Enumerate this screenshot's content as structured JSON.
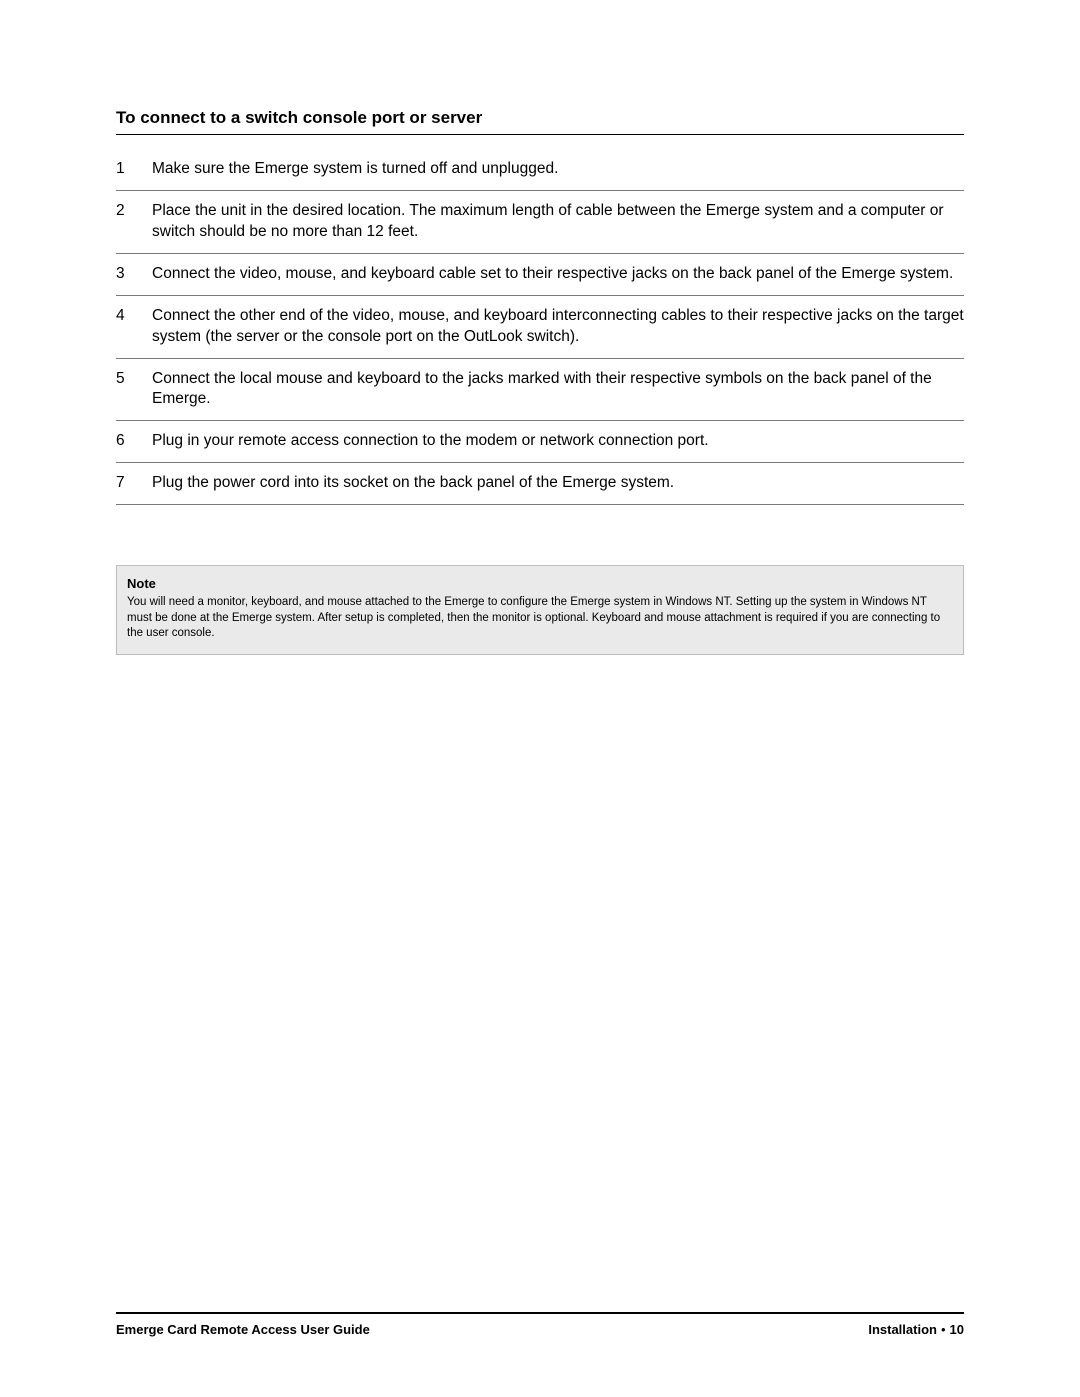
{
  "section": {
    "title": "To connect to a switch console port or server",
    "steps": [
      {
        "n": "1",
        "text": "Make sure the Emerge system is turned off and unplugged."
      },
      {
        "n": "2",
        "text": "Place the unit in the desired location. The maximum length of cable between the Emerge system and a computer or switch should be no more than 12 feet."
      },
      {
        "n": "3",
        "text": "Connect the video, mouse, and keyboard cable set to their respective jacks on the back panel of the Emerge system."
      },
      {
        "n": "4",
        "text": "Connect the other end of the video, mouse, and keyboard interconnecting cables to their respective jacks on the target system (the server or the console port on the OutLook switch)."
      },
      {
        "n": "5",
        "text": "Connect the local mouse and keyboard to the jacks marked with their respective symbols on the back panel of the Emerge."
      },
      {
        "n": "6",
        "text": "Plug in your remote access connection to the modem or network connection port."
      },
      {
        "n": "7",
        "text": "Plug the power cord into its socket on the back panel of the Emerge system."
      }
    ]
  },
  "note": {
    "title": "Note",
    "body": "You will need a monitor, keyboard, and mouse attached to the Emerge to configure the Emerge system in Windows NT. Setting up the system in Windows NT must be done at the Emerge system. After setup is completed, then the monitor is optional. Keyboard and mouse attachment is required if you are connecting to the user console."
  },
  "footer": {
    "left": "Emerge Card Remote Access User Guide",
    "right_section": "Installation",
    "right_page": "10",
    "dot": "•"
  }
}
